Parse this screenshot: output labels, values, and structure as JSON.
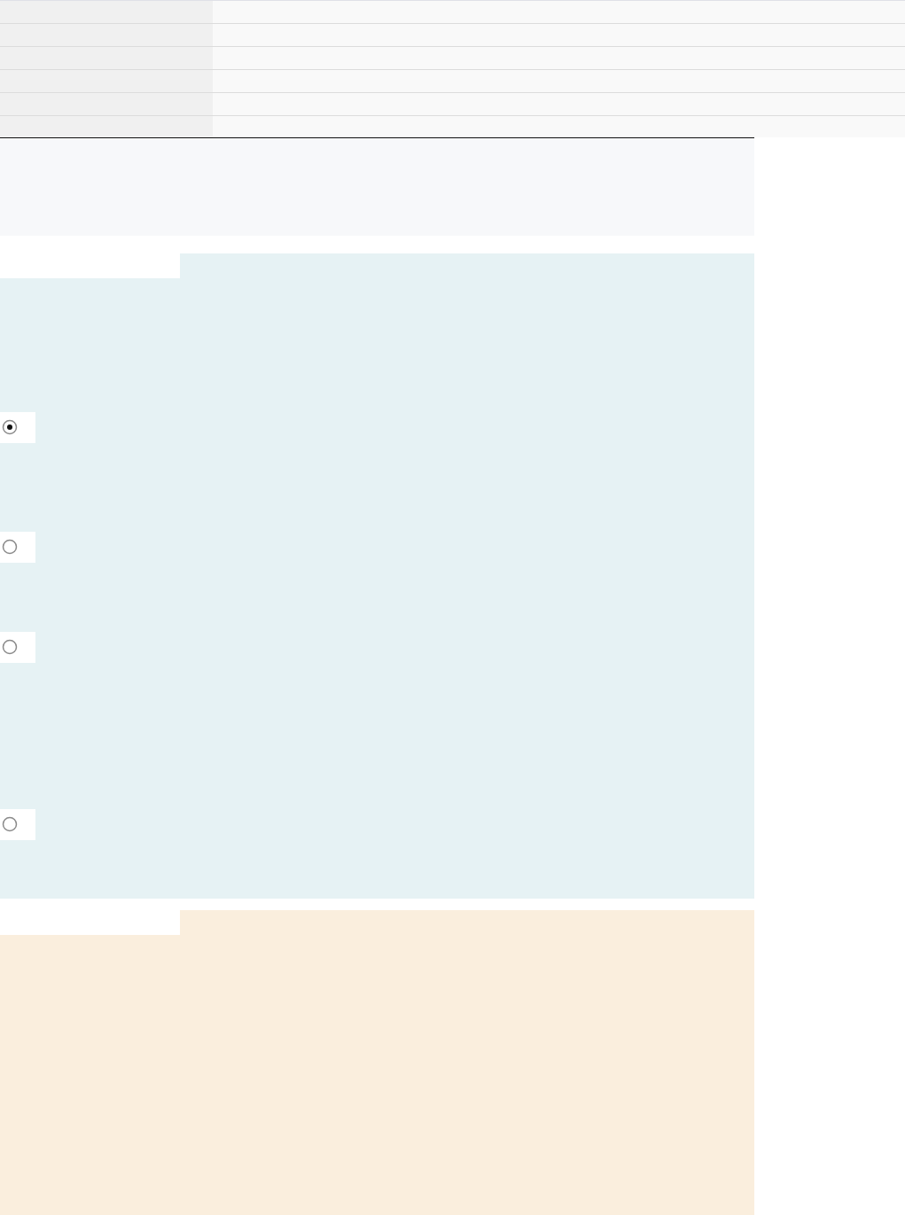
{
  "table": {
    "rows": [
      {
        "kind": "field"
      },
      {
        "kind": "field"
      },
      {
        "kind": "field"
      },
      {
        "kind": "field"
      },
      {
        "kind": "field"
      },
      {
        "kind": "field"
      }
    ]
  },
  "panels": [
    {
      "kind": "plain"
    },
    {
      "kind": "tabbed",
      "color": "#e6f2f4",
      "options": [
        {
          "selected": true
        },
        {
          "selected": false
        },
        {
          "selected": false
        },
        {
          "selected": false
        }
      ]
    },
    {
      "kind": "tabbed",
      "color": "#faeedd"
    }
  ]
}
